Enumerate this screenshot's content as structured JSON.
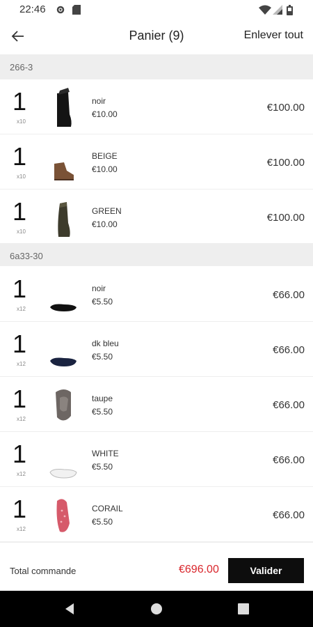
{
  "status": {
    "time": "22:46"
  },
  "header": {
    "title": "Panier (9)",
    "clear_all": "Enlever tout"
  },
  "groups": [
    {
      "name": "266-3",
      "items": [
        {
          "qty": "1",
          "multiplier": "x10",
          "color": "noir",
          "unit_price": "€10.00",
          "total": "€100.00",
          "shoe": "tall-black-boot"
        },
        {
          "qty": "1",
          "multiplier": "x10",
          "color": "BEIGE",
          "unit_price": "€10.00",
          "total": "€100.00",
          "shoe": "brown-ankle-boot"
        },
        {
          "qty": "1",
          "multiplier": "x10",
          "color": "GREEN",
          "unit_price": "€10.00",
          "total": "€100.00",
          "shoe": "olive-boot"
        }
      ]
    },
    {
      "name": "6a33-30",
      "items": [
        {
          "qty": "1",
          "multiplier": "x12",
          "color": "noir",
          "unit_price": "€5.50",
          "total": "€66.00",
          "shoe": "black-flat"
        },
        {
          "qty": "1",
          "multiplier": "x12",
          "color": "dk bleu",
          "unit_price": "€5.50",
          "total": "€66.00",
          "shoe": "navy-flat"
        },
        {
          "qty": "1",
          "multiplier": "x12",
          "color": "taupe",
          "unit_price": "€5.50",
          "total": "€66.00",
          "shoe": "taupe-flat"
        },
        {
          "qty": "1",
          "multiplier": "x12",
          "color": "WHITE",
          "unit_price": "€5.50",
          "total": "€66.00",
          "shoe": "white-flat"
        },
        {
          "qty": "1",
          "multiplier": "x12",
          "color": "CORAIL",
          "unit_price": "€5.50",
          "total": "€66.00",
          "shoe": "coral-flat"
        }
      ]
    }
  ],
  "footer": {
    "label": "Total commande",
    "amount": "€696.00",
    "validate": "Valider"
  },
  "colors": {
    "accent_price": "#d9262c",
    "button_bg": "#0d0d0d",
    "group_bg": "#eeeeee"
  }
}
